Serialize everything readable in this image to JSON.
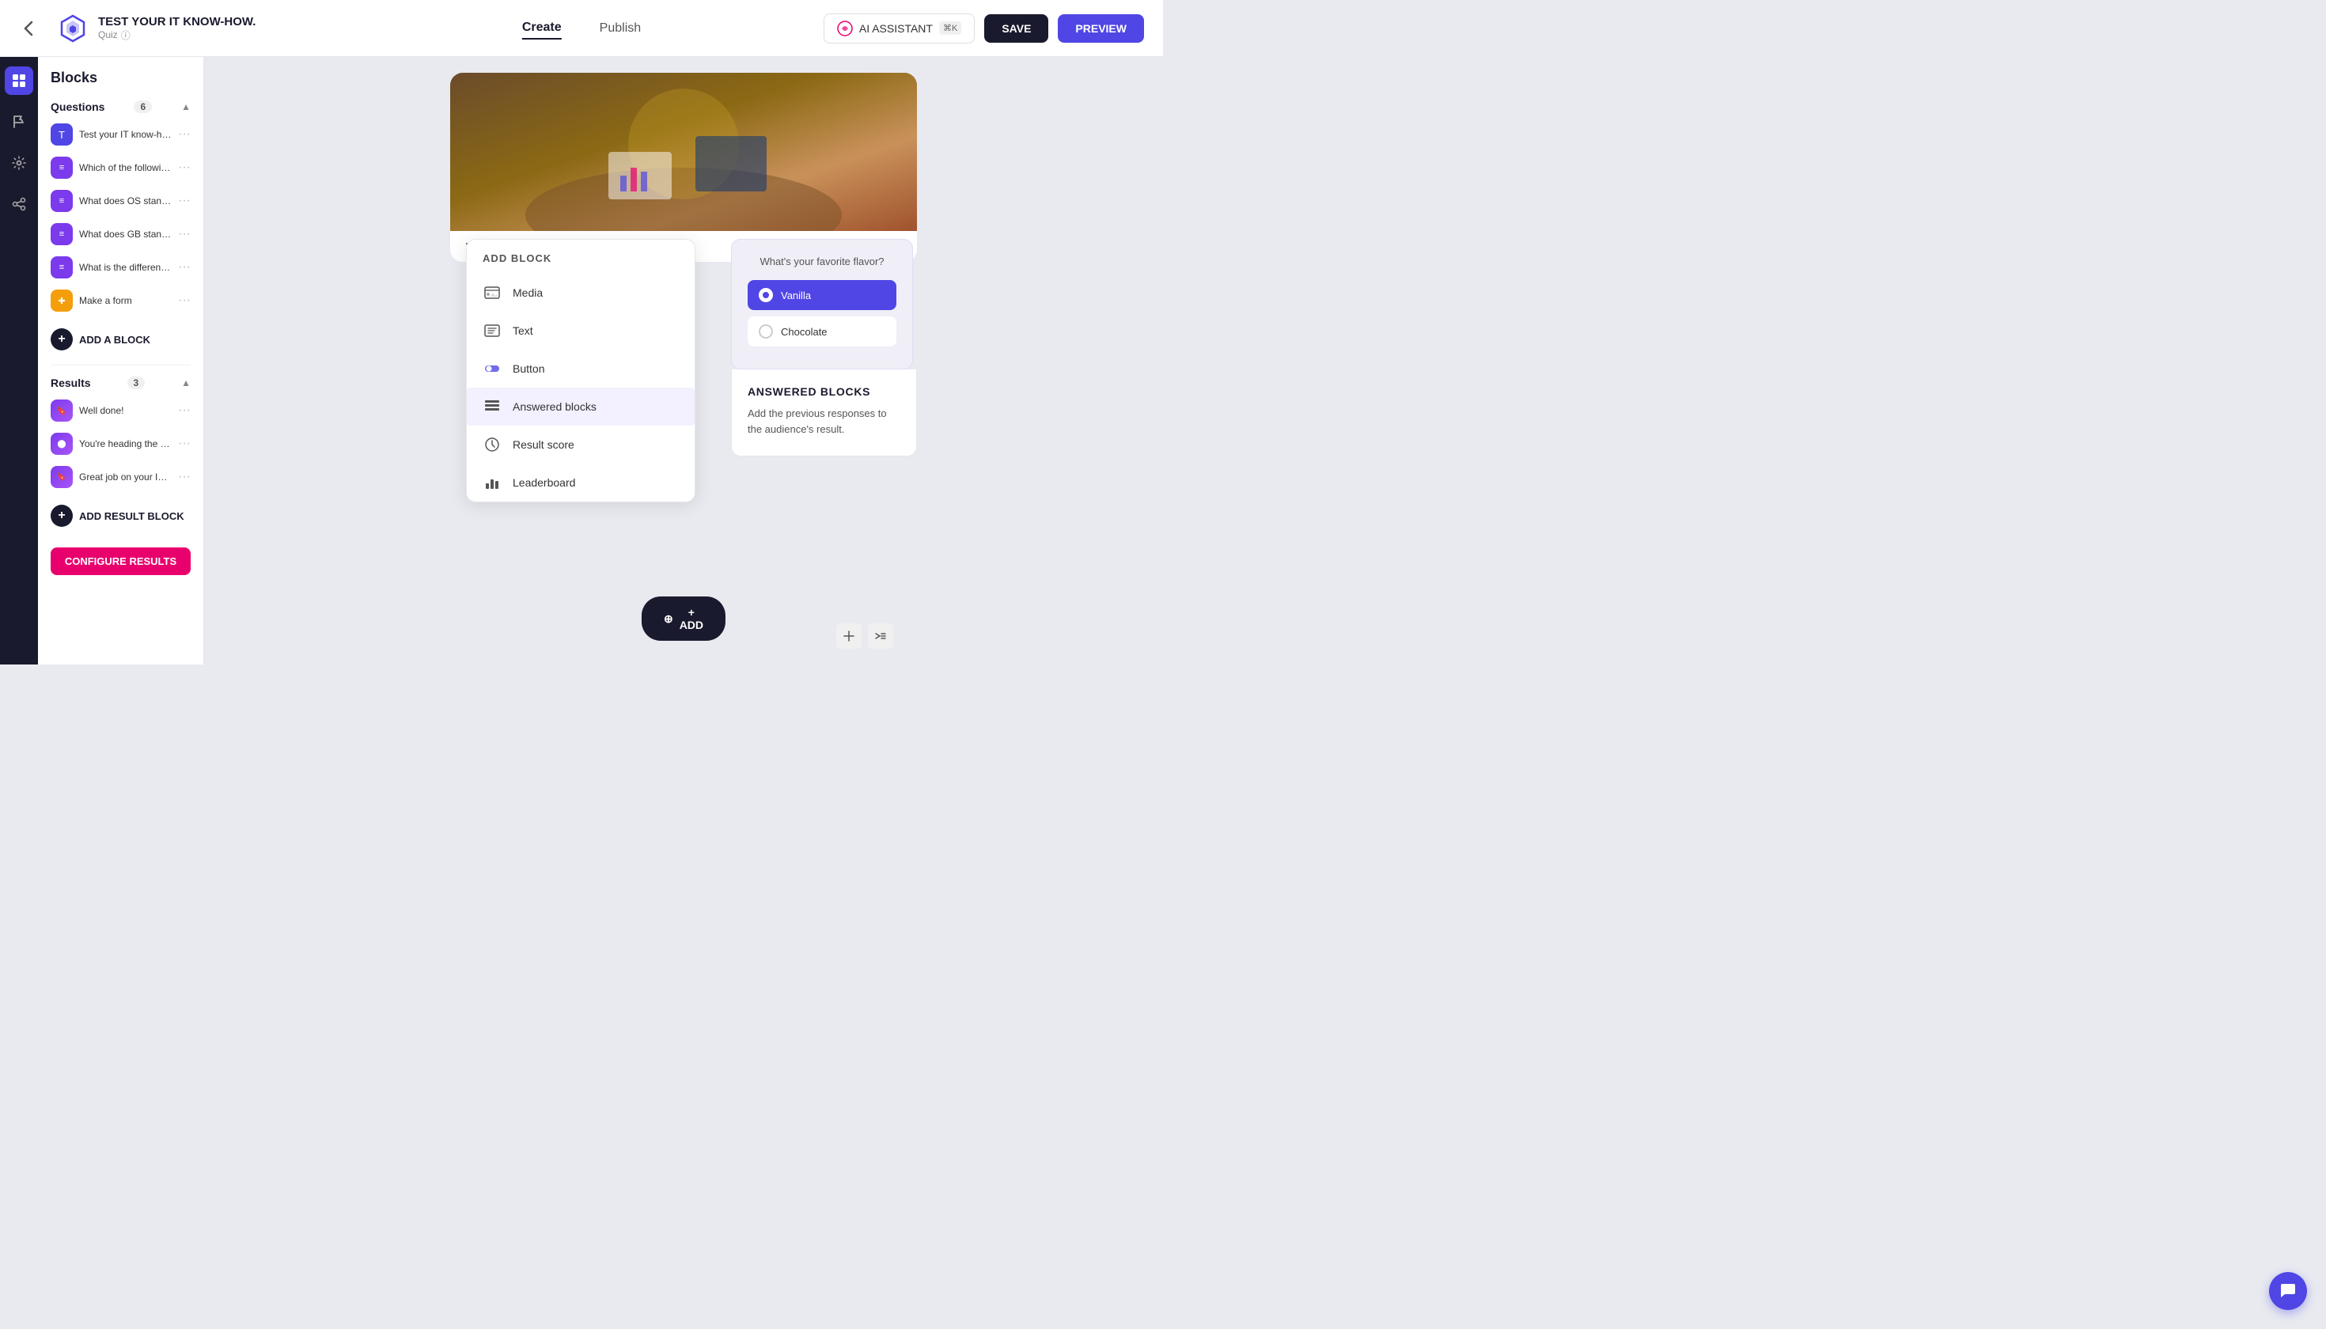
{
  "topnav": {
    "back_icon": "←",
    "quiz_title": "TEST YOUR IT KNOW-HOW.",
    "quiz_type": "Quiz",
    "info_icon": "ⓘ",
    "edit_icon": "✏️",
    "nav_tabs": [
      {
        "label": "Create",
        "active": true
      },
      {
        "label": "Publish",
        "active": false
      }
    ],
    "ai_button": "AI ASSISTANT",
    "ai_shortcut": "⌘K",
    "save_label": "SAVE",
    "preview_label": "PREVIEW"
  },
  "sidebar": {
    "blocks_title": "Blocks",
    "questions_label": "Questions",
    "questions_count": "6",
    "questions": [
      {
        "label": "Test your IT know-how",
        "type": "T",
        "color": "blue"
      },
      {
        "label": "Which of the following is not ...",
        "type": "list",
        "color": "purple"
      },
      {
        "label": "What does OS stand for?",
        "type": "list",
        "color": "purple"
      },
      {
        "label": "What does GB stand for?",
        "type": "list",
        "color": "purple"
      },
      {
        "label": "What is the difference betwe...",
        "type": "list",
        "color": "purple"
      },
      {
        "label": "Make a form",
        "type": "form",
        "color": "yellow"
      }
    ],
    "add_block_label": "ADD A BLOCK",
    "results_label": "Results",
    "results_count": "3",
    "results": [
      {
        "label": "Well done!",
        "type": "bookmark"
      },
      {
        "label": "You're heading the right way.",
        "type": "toggle"
      },
      {
        "label": "Great job on your IT knowled...",
        "type": "toggle-bookmark"
      }
    ],
    "add_result_label": "ADD RESULT BLOCK",
    "configure_btn": "CONFIGURE RESULTS"
  },
  "add_block_panel": {
    "title": "ADD BLOCK",
    "items": [
      {
        "label": "Media",
        "icon": "media"
      },
      {
        "label": "Text",
        "icon": "text"
      },
      {
        "label": "Button",
        "icon": "button"
      },
      {
        "label": "Answered blocks",
        "icon": "answered",
        "highlighted": true
      },
      {
        "label": "Result score",
        "icon": "score"
      },
      {
        "label": "Leaderboard",
        "icon": "leaderboard"
      }
    ]
  },
  "preview_panel": {
    "question": "What's your favorite flavor?",
    "options": [
      {
        "label": "Vanilla",
        "selected": true
      },
      {
        "label": "Chocolate",
        "selected": false
      }
    ]
  },
  "answered_blocks": {
    "title": "ANSWERED BLOCKS",
    "description": "Add the previous responses to the audience's result."
  },
  "add_button": "+ ADD",
  "chat_icon": "💬"
}
